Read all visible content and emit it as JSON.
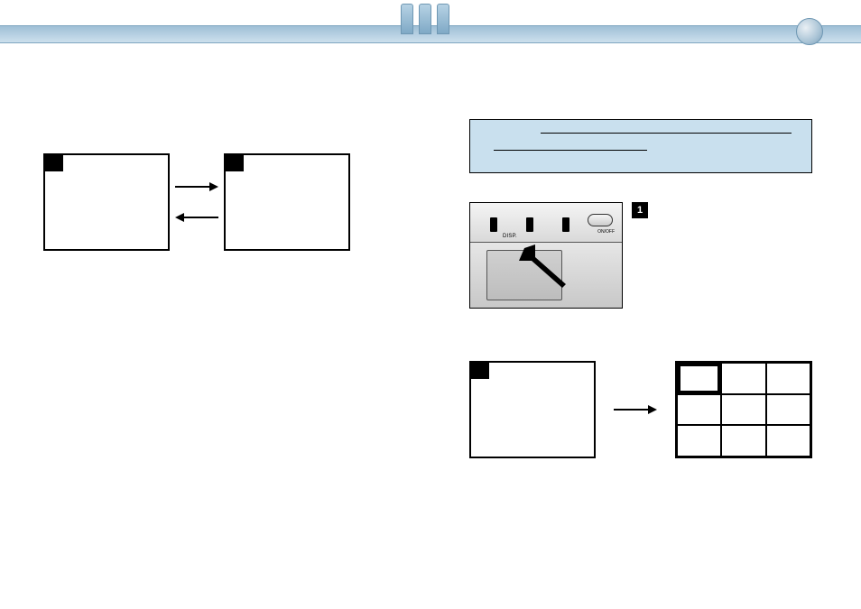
{
  "topbar": {},
  "callout": {},
  "camera": {
    "labels": {
      "disp": "DISP.",
      "lock": "",
      "onoff": "ON/OFF"
    }
  },
  "badge": "1"
}
